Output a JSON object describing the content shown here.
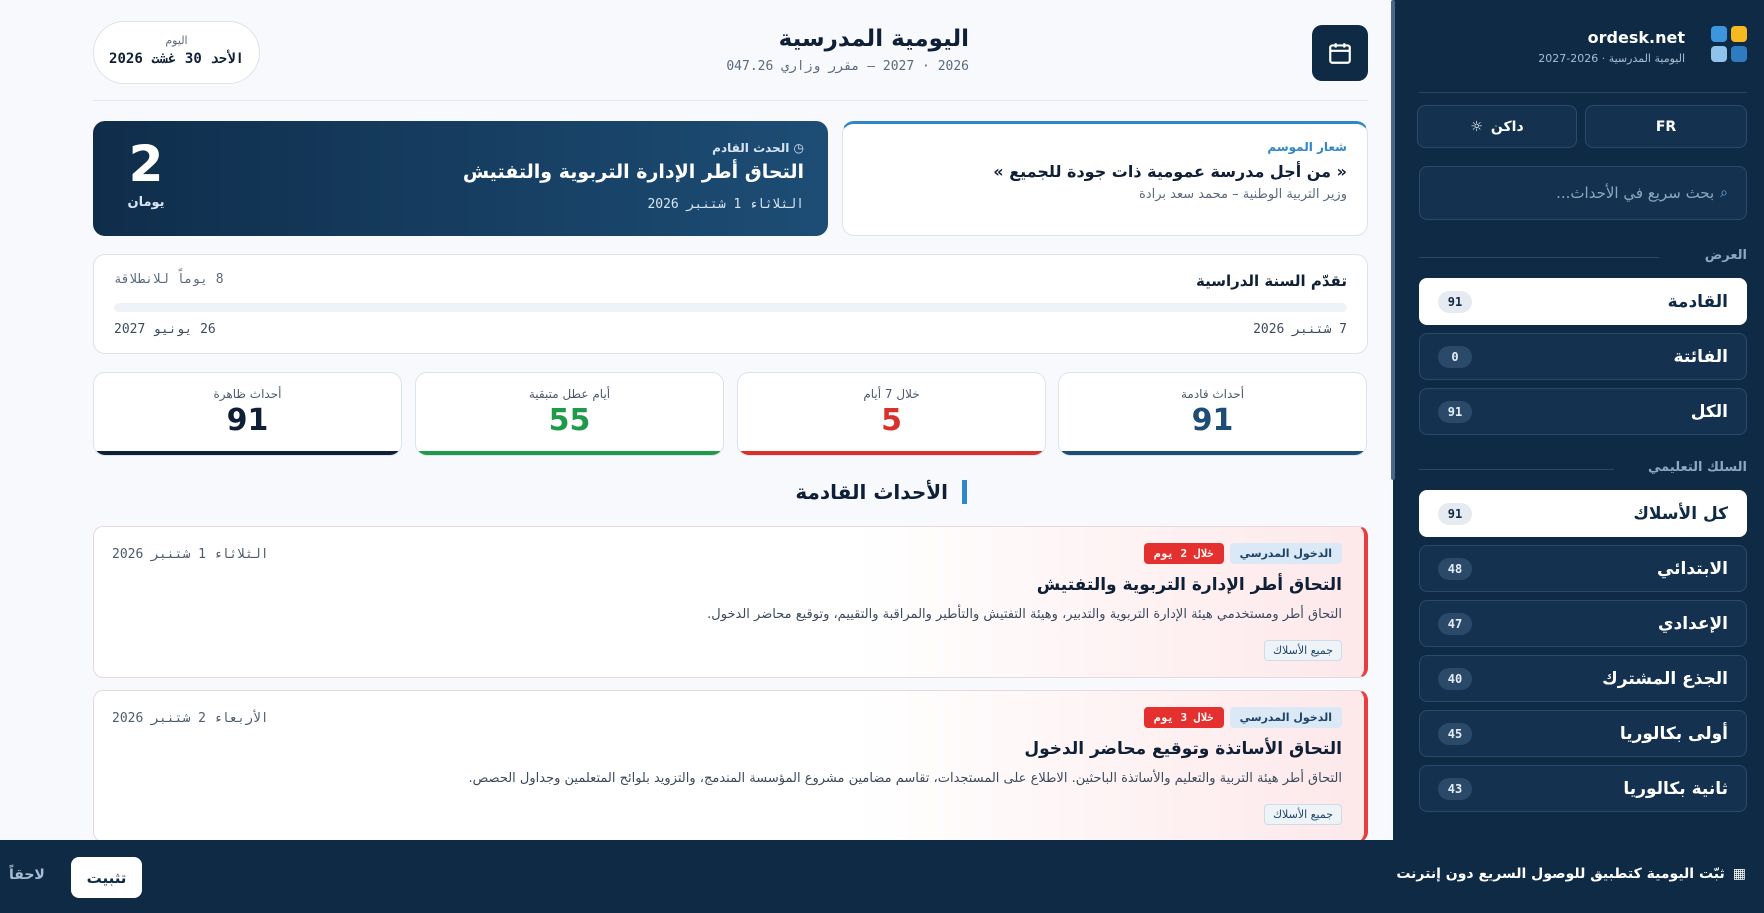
{
  "brand": {
    "name": "ordesk.net",
    "subtitle": "اليومية المدرسية · 2026-2027"
  },
  "sidebar": {
    "lang_button": "FR",
    "theme_button": "داكن",
    "search_placeholder": "بحث سريع في الأحداث...",
    "view_heading": "العرض",
    "view_items": [
      {
        "label": "القادمة",
        "count": "91",
        "active": true
      },
      {
        "label": "الفائتة",
        "count": "0",
        "active": false
      },
      {
        "label": "الكل",
        "count": "91",
        "active": false
      }
    ],
    "levels_heading": "السلك التعليمي",
    "level_items": [
      {
        "label": "كل الأسلاك",
        "count": "91",
        "active": true
      },
      {
        "label": "الابتدائي",
        "count": "48",
        "active": false
      },
      {
        "label": "الإعدادي",
        "count": "47",
        "active": false
      },
      {
        "label": "الجذع المشترك",
        "count": "40",
        "active": false
      },
      {
        "label": "أولى بكالوريا",
        "count": "45",
        "active": false
      },
      {
        "label": "ثانية بكالوريا",
        "count": "43",
        "active": false
      }
    ]
  },
  "header": {
    "title": "اليومية المدرسية",
    "subtitle": "2026 · 2027 — مقرر وزاري 047.26",
    "today_label": "اليوم",
    "today_date": "الأحد 30 غشت 2026"
  },
  "motto": {
    "label": "شعار الموسم",
    "text": "« من أجل مدرسة عمومية ذات جودة للجميع »",
    "author": "وزير التربية الوطنية – محمد سعد برادة"
  },
  "next_event": {
    "label": "الحدث القادم",
    "title": "التحاق أطر الإدارة التربوية والتفتيش",
    "date": "الثلاثاء 1 شتنبر 2026",
    "count": "2",
    "unit": "يومان"
  },
  "progress": {
    "title": "تقدّم السنة الدراسية",
    "days_left": "8 يوماً للانطلاقة",
    "start": "7 شتنبر 2026",
    "end": "26 يونيو 2027",
    "fraction": 0
  },
  "stats": [
    {
      "label": "أحداث قادمة",
      "value": "91",
      "color": "#1d4d75"
    },
    {
      "label": "خلال 7 أيام",
      "value": "5",
      "color": "#d9302c"
    },
    {
      "label": "أيام عطل متبقية",
      "value": "55",
      "color": "#1f9a4a"
    },
    {
      "label": "أحداث ظاهرة",
      "value": "91",
      "color": "#0f1f35"
    }
  ],
  "section_title": "الأحداث القادمة",
  "events": [
    {
      "category": "الدخول المدرسي",
      "soon": "خلال 2 يوم",
      "title": "التحاق أطر الإدارة التربوية والتفتيش",
      "description": "التحاق أطر ومستخدمي هيئة الإدارة التربوية والتدبير، وهيئة التفتيش والتأطير والمراقبة والتقييم، وتوقيع محاضر الدخول.",
      "level": "جميع الأسلاك",
      "date": "الثلاثاء 1 شتنبر 2026"
    },
    {
      "category": "الدخول المدرسي",
      "soon": "خلال 3 يوم",
      "title": "التحاق الأساتذة وتوقيع محاضر الدخول",
      "description": "التحاق أطر هيئة التربية والتعليم والأساتذة الباحثين. الاطلاع على المستجدات، تقاسم مضامين مشروع المؤسسة المندمج، والتزويد بلوائح المتعلمين وجداول الحصص.",
      "level": "جميع الأسلاك",
      "date": "الأربعاء 2 شتنبر 2026"
    }
  ],
  "install": {
    "message": "ثبّت اليومية كتطبيق للوصول السريع دون إنترنت",
    "install_button": "تثبيت",
    "later_button": "لاحقاً"
  },
  "icons": {
    "header": "calendar-icon",
    "theme": "sun-icon",
    "search": "search-icon",
    "clock": "clock-icon",
    "install": "app-icon"
  }
}
